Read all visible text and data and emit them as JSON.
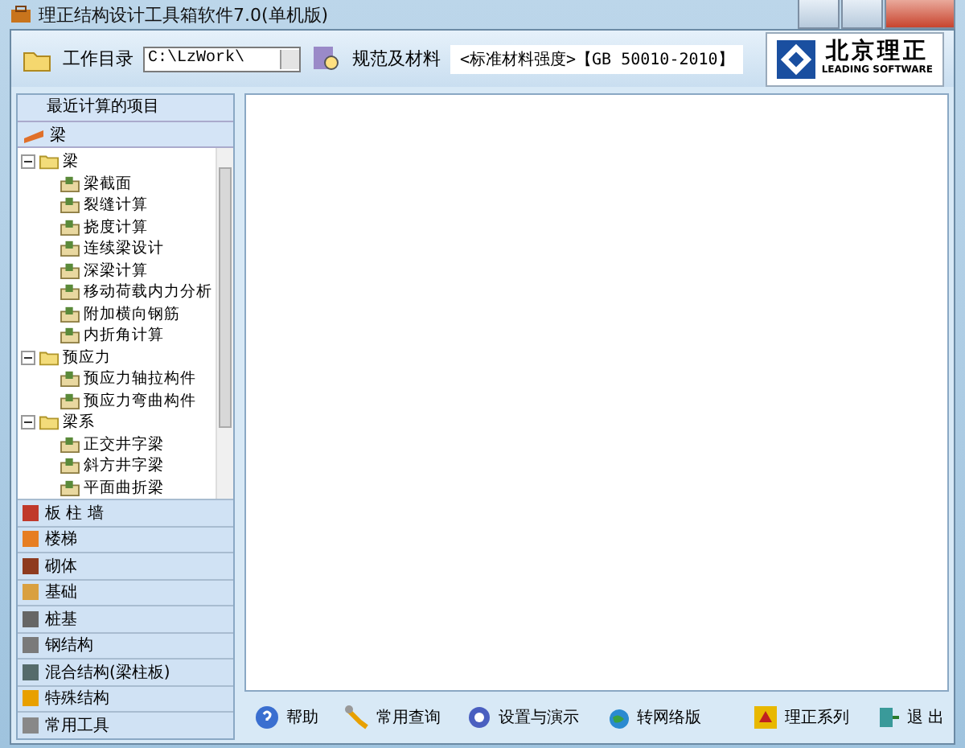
{
  "window": {
    "title": "理正结构设计工具箱软件7.0(单机版)"
  },
  "toolbar": {
    "workdir_label": "工作目录",
    "workdir_value": "C:\\LzWork\\",
    "spec_label": "规范及材料",
    "spec_value": "<标准材料强度>【GB 50010-2010】",
    "logo_title": "北京理正",
    "logo_subtitle": "LEADING SOFTWARE"
  },
  "sidebar": {
    "recent": "最近计算的项目",
    "current_group": "梁",
    "tree": [
      {
        "label": "梁",
        "expanded": true,
        "children": [
          {
            "label": "梁截面"
          },
          {
            "label": "裂缝计算"
          },
          {
            "label": "挠度计算"
          },
          {
            "label": "连续梁设计"
          },
          {
            "label": "深梁计算"
          },
          {
            "label": "移动荷载内力分析"
          },
          {
            "label": "附加横向钢筋"
          },
          {
            "label": "内折角计算"
          }
        ]
      },
      {
        "label": "预应力",
        "expanded": true,
        "children": [
          {
            "label": "预应力轴拉构件"
          },
          {
            "label": "预应力弯曲构件"
          }
        ]
      },
      {
        "label": "梁系",
        "expanded": true,
        "children": [
          {
            "label": "正交井字梁"
          },
          {
            "label": "斜方井字梁"
          },
          {
            "label": "平面曲折梁"
          }
        ]
      }
    ],
    "groups": [
      {
        "label": "板 柱 墙",
        "kind": "slab"
      },
      {
        "label": "楼梯",
        "kind": "stair"
      },
      {
        "label": "砌体",
        "kind": "masonry"
      },
      {
        "label": "基础",
        "kind": "foundation"
      },
      {
        "label": "桩基",
        "kind": "pile"
      },
      {
        "label": "钢结构",
        "kind": "steel"
      },
      {
        "label": "混合结构(梁柱板)",
        "kind": "mixed"
      },
      {
        "label": "特殊结构",
        "kind": "special"
      },
      {
        "label": "常用工具",
        "kind": "tools"
      }
    ]
  },
  "bottom_bar": [
    {
      "label": "帮助",
      "kind": "help"
    },
    {
      "label": "常用查询",
      "kind": "wrench"
    },
    {
      "label": "设置与演示",
      "kind": "gear"
    },
    {
      "label": "转网络版",
      "kind": "globe"
    },
    {
      "label": "理正系列",
      "kind": "logo"
    },
    {
      "label": "退 出",
      "kind": "exit"
    }
  ]
}
